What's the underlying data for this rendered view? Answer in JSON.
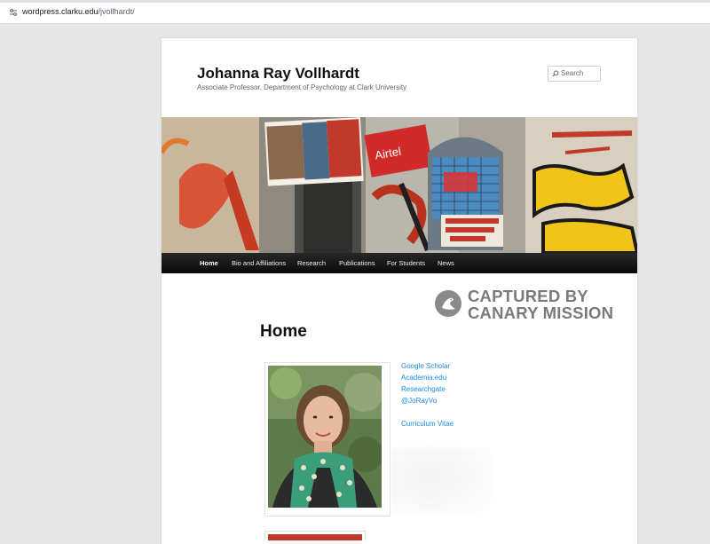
{
  "browser": {
    "url_host": "wordpress.clarku.edu",
    "url_path": "/jvollhardt/"
  },
  "site": {
    "title": "Johanna Ray Vollhardt",
    "description": "Associate Professor, Department of Psychology at Clark University"
  },
  "search": {
    "placeholder": "Search"
  },
  "nav": {
    "items": [
      {
        "label": "Home"
      },
      {
        "label": "Bio and Affiliations"
      },
      {
        "label": "Research"
      },
      {
        "label": "Publications"
      },
      {
        "label": "For Students"
      },
      {
        "label": "News"
      }
    ],
    "active": "Home"
  },
  "banner": {
    "poster_text": "Airtel"
  },
  "watermark": {
    "line1": "CAPTURED BY",
    "line2": "CANARY MISSION"
  },
  "main": {
    "title": "Home",
    "links": [
      {
        "label": "Google Scholar"
      },
      {
        "label": "Academia.edu"
      },
      {
        "label": "Researchgate"
      },
      {
        "label": "@JoRayVo"
      },
      {
        "label": "Curriculum Vitae"
      }
    ]
  },
  "colors": {
    "link": "#1b8be0",
    "nav_bg": "#1a1a1a",
    "watermark": "#7a7a7a"
  }
}
